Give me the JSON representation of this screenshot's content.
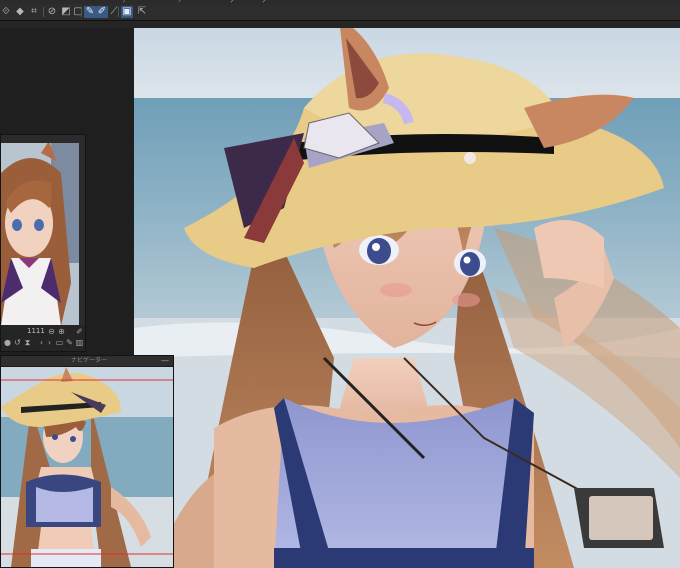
{
  "menubar": {
    "items": [
      "ﾂ",
      "ﾝ",
      "ﾀ",
      "ﾀ"
    ]
  },
  "toolbar": {
    "buttons": [
      {
        "name": "transform-icon",
        "glyph": "⟐"
      },
      {
        "name": "fill-icon",
        "glyph": "◆"
      },
      {
        "name": "crop-icon",
        "glyph": "⌗"
      },
      {
        "name": "clear-icon",
        "glyph": "⊘"
      },
      {
        "name": "gradient-icon",
        "glyph": "◩"
      },
      {
        "name": "frame-icon",
        "glyph": "▢"
      },
      {
        "name": "pen-icon",
        "glyph": "✎"
      },
      {
        "name": "brush-icon",
        "glyph": "✐"
      },
      {
        "name": "ruler-icon",
        "glyph": "⟋"
      },
      {
        "name": "layer-icon",
        "glyph": "▣"
      },
      {
        "name": "export-icon",
        "glyph": "⇱"
      }
    ]
  },
  "sub_view": {
    "zoom_label": "1111"
  },
  "navigator": {
    "title": "ナビゲーター",
    "close_glyph": "—"
  },
  "colors": {
    "ui_dark": "#1e1e1e",
    "panel": "#2b2b2b",
    "accent": "#3a5a86",
    "nav_frame": "#e03030"
  }
}
